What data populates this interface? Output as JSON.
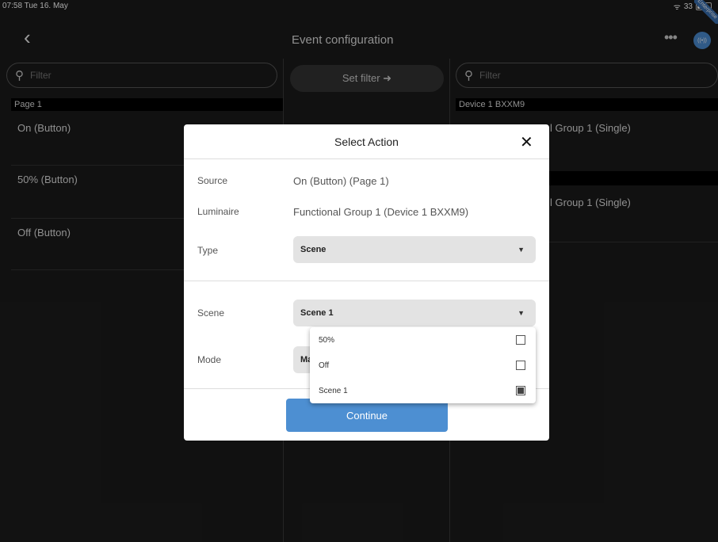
{
  "status": {
    "time": "07:58  Tue 16. May",
    "battery": "33",
    "ribbon": "Enterprise"
  },
  "nav": {
    "back": "‹",
    "title": "Event configuration",
    "more": "•••",
    "signal": "((•))"
  },
  "left": {
    "filter_placeholder": "Filter",
    "section": "Page 1",
    "items": [
      "On (Button)",
      "50% (Button)",
      "Off (Button)"
    ]
  },
  "middle": {
    "set_filter": "Set filter ➜"
  },
  "right": {
    "filter_placeholder": "Filter",
    "section": "Device 1 BXXM9",
    "items": [
      "Functional Group 1 (Single)",
      "Functional Group 1 (Single)"
    ],
    "visible_items": [
      "l Group 1 (Single)",
      "l Group 1 (Single)"
    ],
    "visible_prefix": "Functio"
  },
  "dialog": {
    "title": "Select Action",
    "close": "✕",
    "source_label": "Source",
    "source_value": "On (Button) (Page 1)",
    "luminaire_label": "Luminaire",
    "luminaire_value": "Functional Group 1 (Device 1 BXXM9)",
    "type_label": "Type",
    "type_value": "Scene",
    "scene_label": "Scene",
    "scene_value": "Scene 1",
    "mode_label": "Mode",
    "mode_value": "Ma",
    "continue": "Continue"
  },
  "dropdown": {
    "options": [
      {
        "label": "50%",
        "checked": false
      },
      {
        "label": "Off",
        "checked": false
      },
      {
        "label": "Scene 1",
        "checked": true
      }
    ]
  },
  "colors": {
    "accent": "#4d8fd2",
    "background": "#1b1b1b",
    "dialog": "#ffffff"
  }
}
